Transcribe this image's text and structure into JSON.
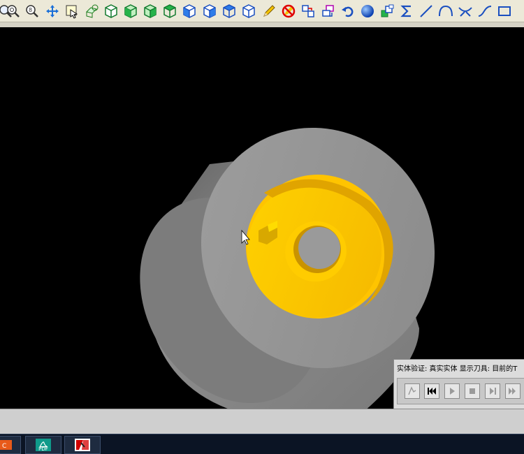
{
  "toolbar": {
    "icons": [
      "zoom-window-icon",
      "zoom-in-icon",
      "zoom-prev-icon",
      "pan-icon",
      "fit-icon",
      "rotate-view-icon",
      "top-view-cube-icon",
      "front-view-cube-icon",
      "side-view-cube-icon",
      "iso-view-cube-icon",
      "cube-view-icon-1",
      "cube-view-icon-2",
      "cube-view-icon-3",
      "cube-view-icon-4",
      "pencil-icon",
      "no-draw-icon",
      "move-icon",
      "copy-icon",
      "undo-rotate-icon",
      "sphere-icon",
      "layer-icon",
      "sigma-icon",
      "line-icon",
      "arc-icon",
      "bow-icon",
      "spline-icon",
      "rectangle-icon"
    ]
  },
  "verify": {
    "title": "实体验证: 真实实体 显示刀具: 目前的T"
  },
  "taskbar": {
    "pdf_label": "PDF"
  },
  "colors": {
    "viewport_bg": "#000000",
    "solid_gray": "#9a9a9a",
    "face_yellow": "#ffc800"
  }
}
